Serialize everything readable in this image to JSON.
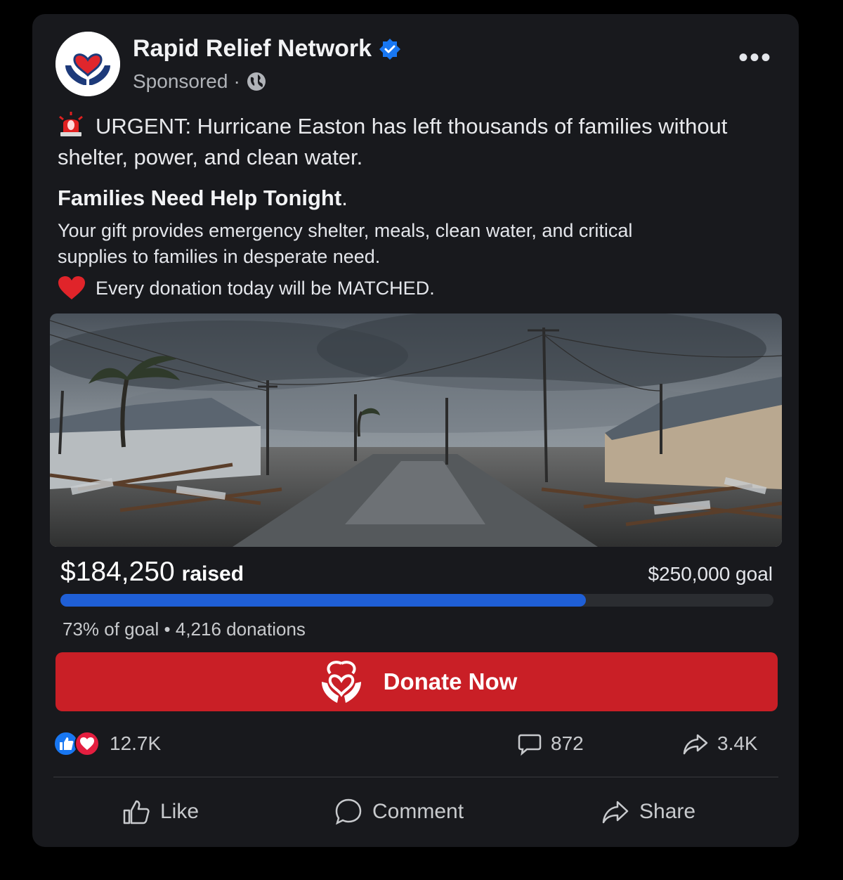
{
  "post": {
    "page_name": "Rapid Relief Network",
    "sponsored_label": "Sponsored",
    "separator": "·",
    "more_label": "•••",
    "urgent_text": "URGENT: Hurricane Easton has left thousands of families without shelter, power, and clean water.",
    "headline": "Families Need Help Tonight",
    "headline_suffix": ".",
    "body": "Your gift provides emergency shelter, meals, clean water, and critical supplies to families in desperate need.",
    "match_text": "Every donation today will be MATCHED."
  },
  "fundraiser": {
    "raised_amount": "$184,250",
    "raised_label": "raised",
    "goal_text": "$250,000 goal",
    "progress_fraction": 0.737,
    "stats_text": "73% of goal • 4,216 donations",
    "donate_label": "Donate Now"
  },
  "engagement": {
    "reactions_count": "12.7K",
    "comments_count": "872",
    "shares_count": "3.4K"
  },
  "actions": {
    "like": "Like",
    "comment": "Comment",
    "share": "Share"
  },
  "colors": {
    "card_bg": "#18191d",
    "accent_blue": "#1f5fd6",
    "donate_red": "#c91f26",
    "verified_blue": "#1877f2"
  },
  "icons": [
    "verified-badge-icon",
    "globe-icon",
    "more-options-icon",
    "siren-icon",
    "heart-icon",
    "hands-heart-icon",
    "like-reaction-icon",
    "love-reaction-icon",
    "comment-icon",
    "share-icon",
    "thumbs-up-icon"
  ]
}
